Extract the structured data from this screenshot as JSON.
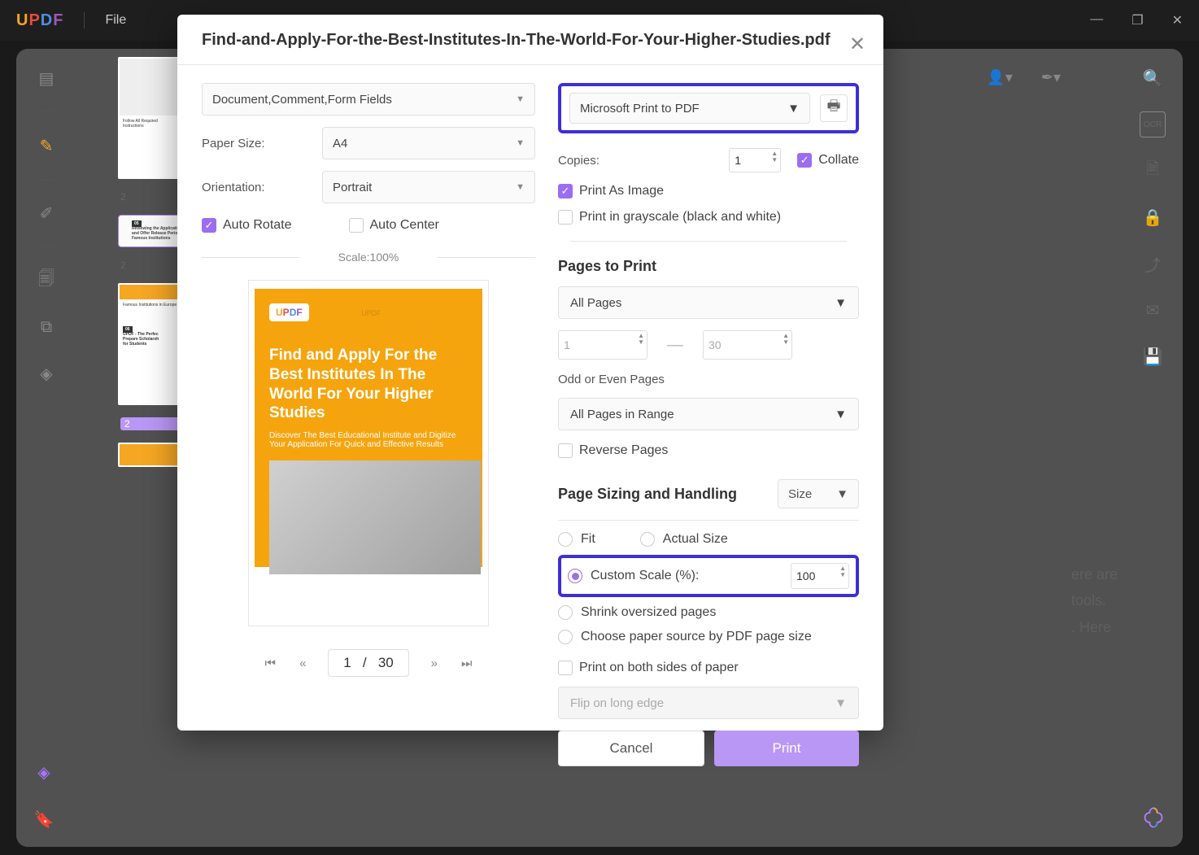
{
  "app": {
    "logo": "UPDF",
    "file_menu": "File"
  },
  "window": {
    "min": "—",
    "max": "❐",
    "close": "✕"
  },
  "modal": {
    "title": "Find-and-Apply-For-the-Best-Institutes-In-The-World-For-Your-Higher-Studies.pdf",
    "content_select": "Document,Comment,Form Fields",
    "paper_size_label": "Paper Size:",
    "paper_size": "A4",
    "orientation_label": "Orientation:",
    "orientation": "Portrait",
    "auto_rotate": "Auto Rotate",
    "auto_center": "Auto Center",
    "scale_label": "Scale:100%",
    "preview": {
      "brand": "UPDF",
      "title": "Find and Apply For the Best Institutes In The World For Your Higher Studies",
      "subtitle": "Discover The Best Educational Institute and Digitize Your Application For Quick and Effective Results"
    },
    "pager": {
      "current": "1",
      "sep": "/",
      "total": "30"
    },
    "printer": "Microsoft Print to PDF",
    "copies_label": "Copies:",
    "copies": "1",
    "collate": "Collate",
    "print_as_image": "Print As Image",
    "print_grayscale": "Print in grayscale (black and white)",
    "pages_to_print": "Pages to Print",
    "pages_mode": "All Pages",
    "range_from": "1",
    "range_to": "30",
    "odd_even_label": "Odd or Even Pages",
    "odd_even": "All Pages in Range",
    "reverse": "Reverse Pages",
    "sizing_header": "Page Sizing and Handling",
    "size_select": "Size",
    "fit": "Fit",
    "actual": "Actual Size",
    "custom_scale_label": "Custom Scale (%):",
    "custom_scale_val": "100",
    "shrink": "Shrink oversized pages",
    "choose_source": "Choose paper source by PDF page size",
    "both_sides": "Print on both sides of paper",
    "flip": "Flip on long edge",
    "cancel": "Cancel",
    "print": "Print"
  },
  "background_text": {
    "l1": "ere are",
    "l2": "tools.",
    "l3": ". Here"
  },
  "thumbs": {
    "p2a": "2",
    "p2b": "2",
    "p2c": "2"
  }
}
